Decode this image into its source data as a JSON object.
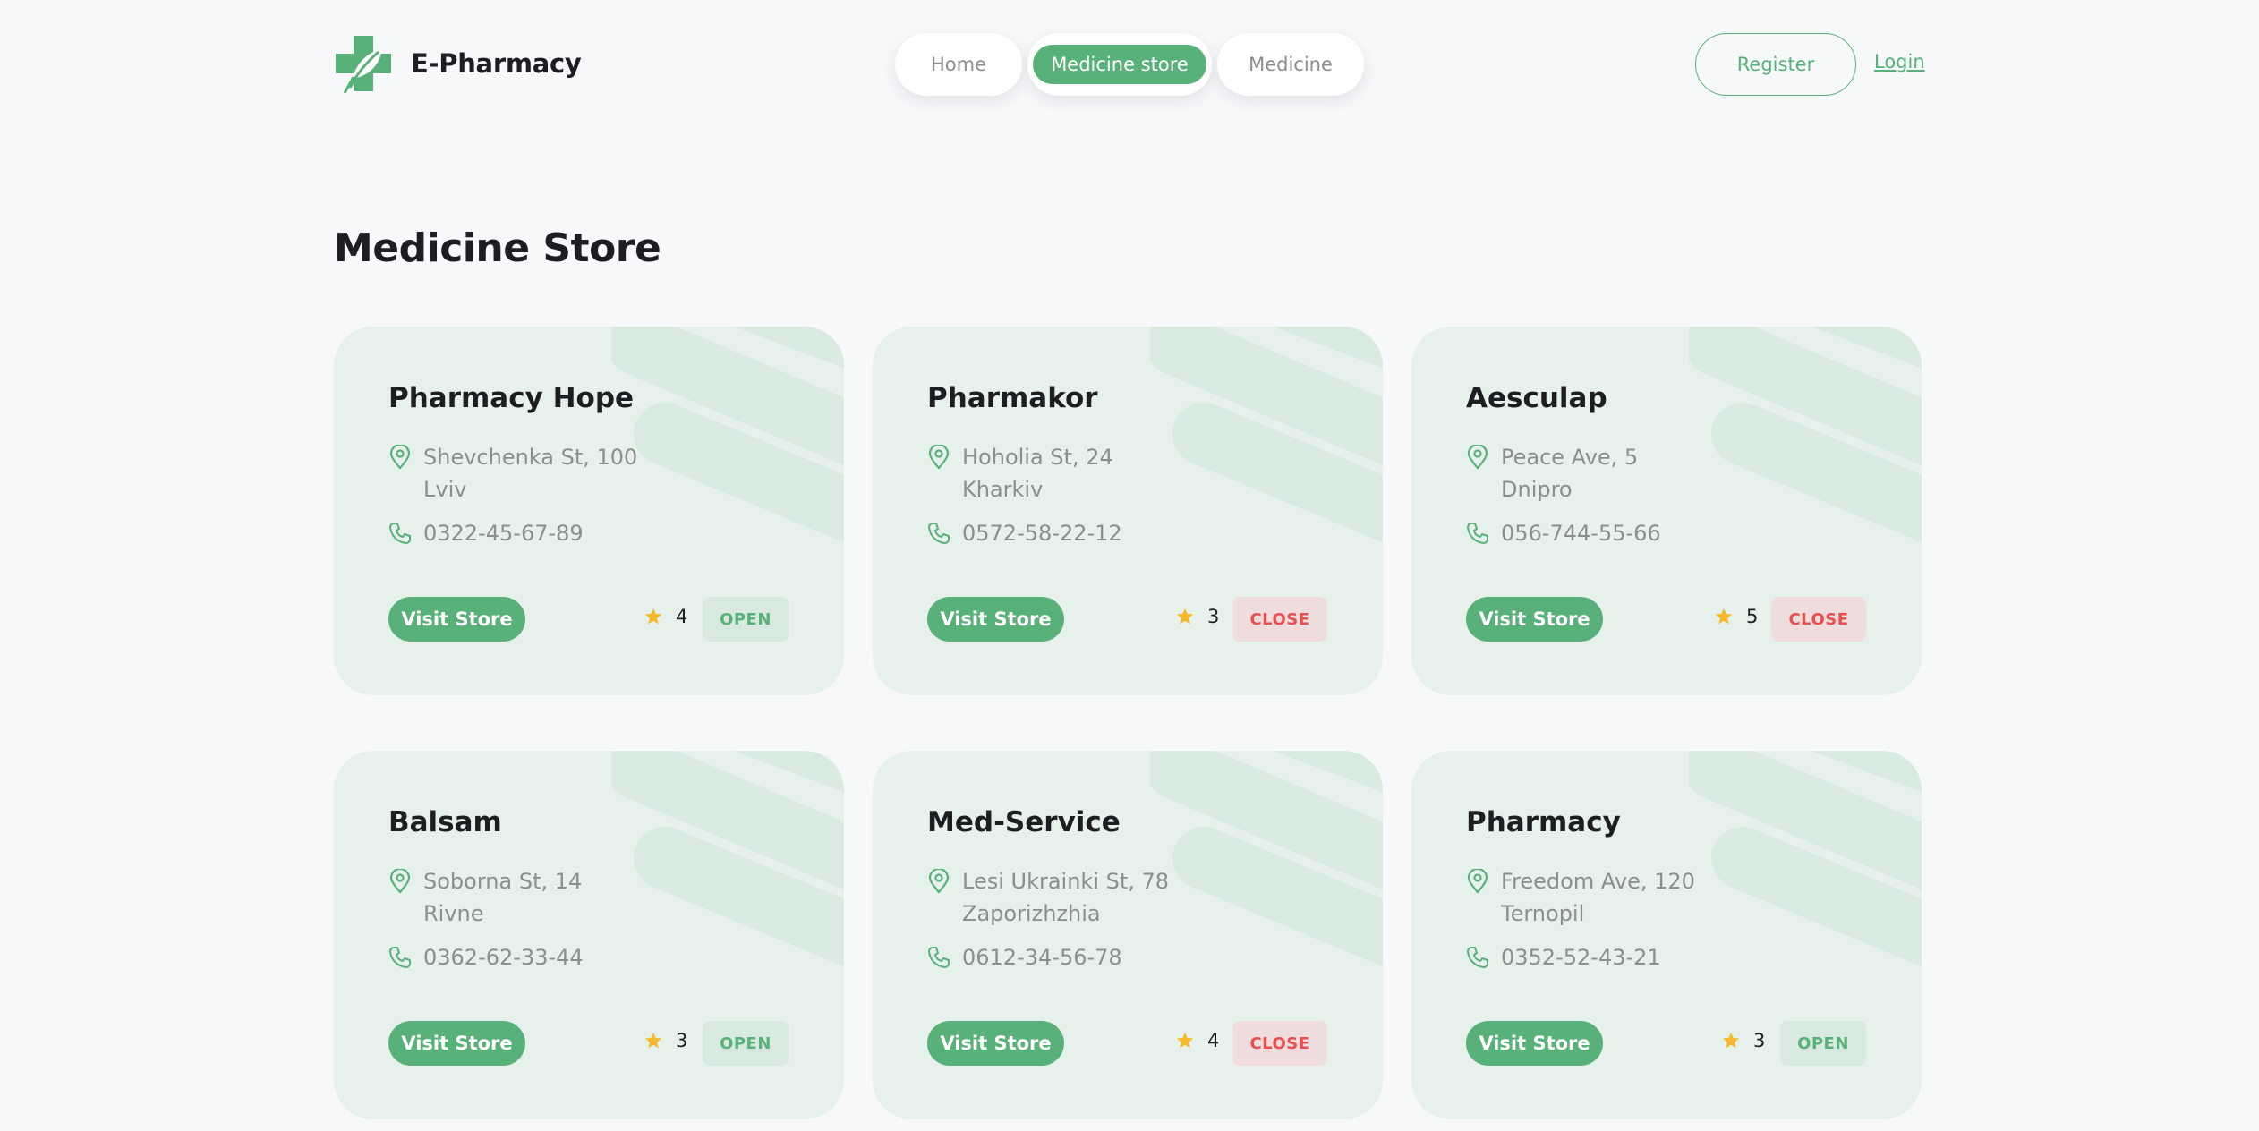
{
  "brand": {
    "name": "E-Pharmacy",
    "accent": "#59b17a"
  },
  "nav": {
    "home": "Home",
    "store": "Medicine store",
    "medicine": "Medicine"
  },
  "auth": {
    "register": "Register",
    "login": "Login"
  },
  "page": {
    "title": "Medicine Store"
  },
  "stores": [
    {
      "name": "Pharmacy Hope",
      "street": "Shevchenka St, 100",
      "city": "Lviv",
      "phone": "0322-45-67-89",
      "visit": "Visit Store",
      "rating": "4",
      "status": "OPEN"
    },
    {
      "name": "Pharmakor",
      "street": "Hoholia St, 24",
      "city": "Kharkiv",
      "phone": "0572-58-22-12",
      "visit": "Visit Store",
      "rating": "3",
      "status": "CLOSE"
    },
    {
      "name": "Aesculap",
      "street": "Peace Ave, 5",
      "city": "Dnipro",
      "phone": "056-744-55-66",
      "visit": "Visit Store",
      "rating": "5",
      "status": "CLOSE"
    },
    {
      "name": "Balsam",
      "street": "Soborna St, 14",
      "city": "Rivne",
      "phone": "0362-62-33-44",
      "visit": "Visit Store",
      "rating": "3",
      "status": "OPEN"
    },
    {
      "name": "Med-Service",
      "street": "Lesi Ukrainki St, 78",
      "city": "Zaporizhzhia",
      "phone": "0612-34-56-78",
      "visit": "Visit Store",
      "rating": "4",
      "status": "CLOSE"
    },
    {
      "name": "Pharmacy",
      "street": "Freedom Ave, 120",
      "city": "Ternopil",
      "phone": "0352-52-43-21",
      "visit": "Visit Store",
      "rating": "3",
      "status": "OPEN"
    }
  ]
}
